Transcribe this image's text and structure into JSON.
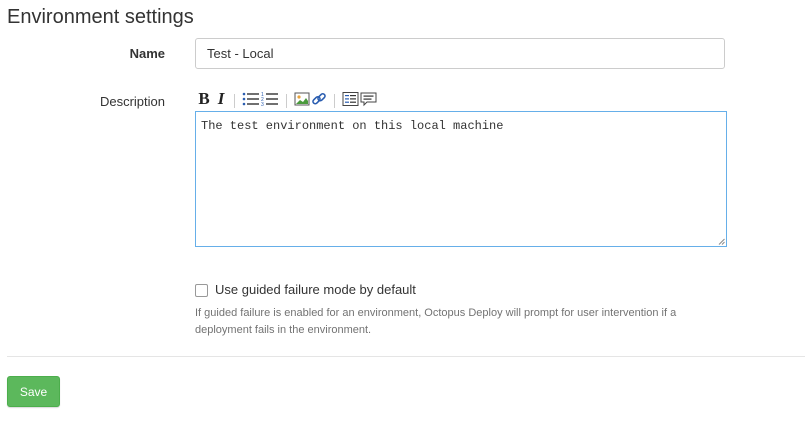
{
  "page": {
    "title": "Environment settings"
  },
  "form": {
    "name_label": "Name",
    "name_value": "Test - Local",
    "description_label": "Description",
    "description_value": "The test environment on this local machine",
    "toolbar": {
      "bold": "B",
      "italic": "I"
    },
    "guided_failure": {
      "checked": false,
      "label": "Use guided failure mode by default",
      "help_line1": "If guided failure is enabled for an environment, Octopus Deploy will prompt for user intervention if a",
      "help_line2": "deployment fails in the environment."
    }
  },
  "actions": {
    "save_label": "Save"
  },
  "colors": {
    "save_button": "#5cb85c",
    "textarea_focus_border": "#66afe9",
    "help_text": "#737373"
  },
  "icons": [
    "bold-icon",
    "italic-icon",
    "bulleted-list-icon",
    "numbered-list-icon",
    "image-icon",
    "link-icon",
    "code-block-icon",
    "quote-icon"
  ]
}
